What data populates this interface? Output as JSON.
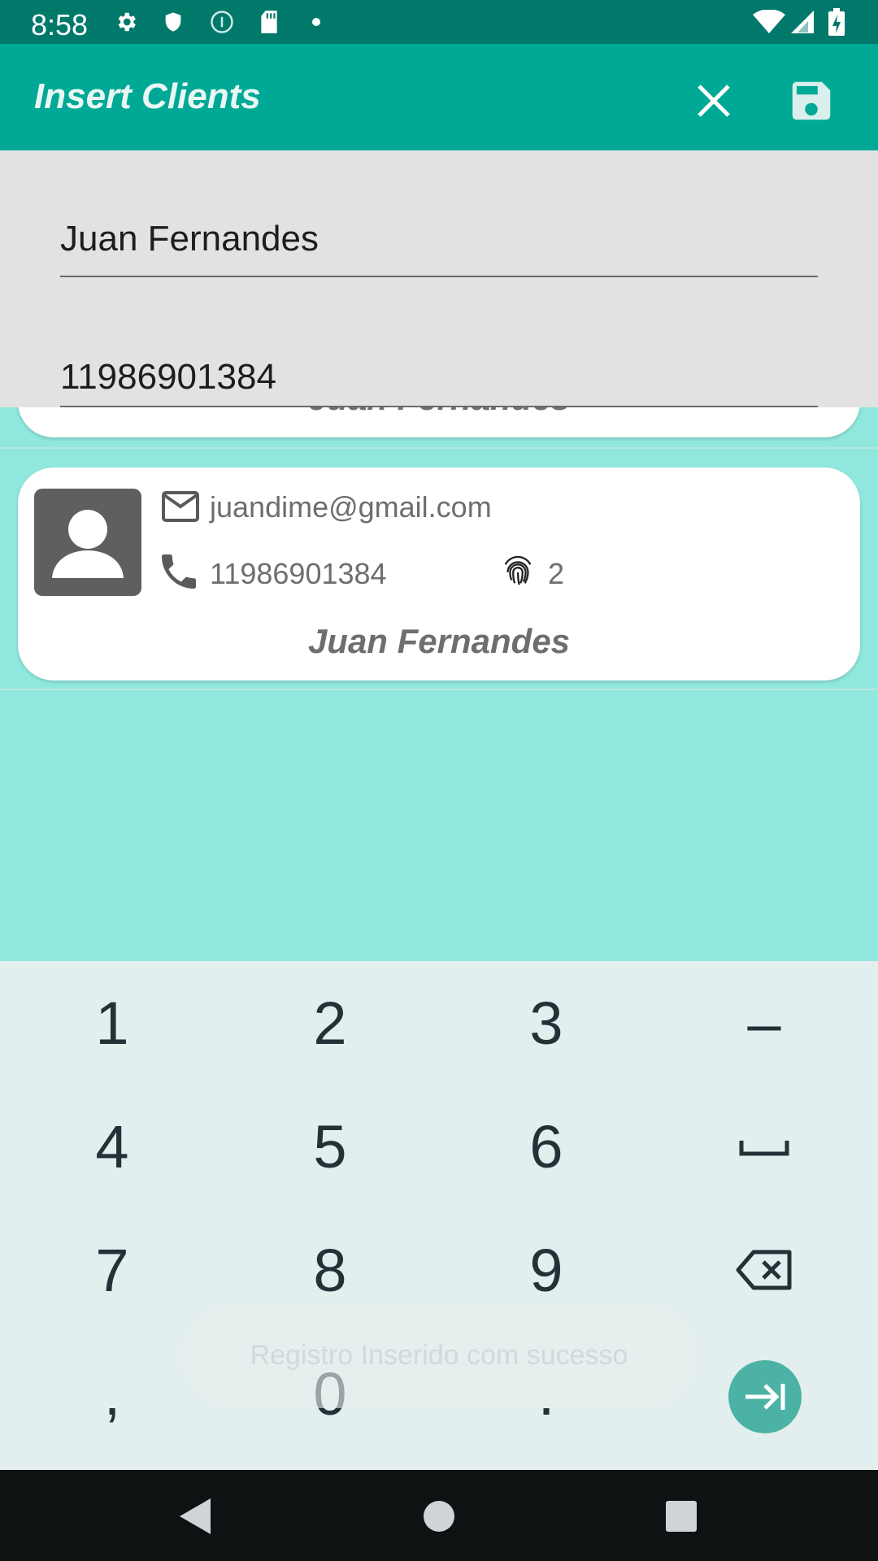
{
  "status_bar": {
    "time": "8:58",
    "icons": [
      "gear-icon",
      "shield-icon",
      "info-circle-icon",
      "sd-card-icon",
      "dot-icon",
      "wifi-icon",
      "signal-icon",
      "battery-icon"
    ]
  },
  "app_bar": {
    "title": "Insert Clients",
    "close_icon": "close-icon",
    "save_icon": "save-icon"
  },
  "form": {
    "name_value": "Juan Fernandes",
    "phone_value": "11986901384"
  },
  "list": {
    "partial_card_name": "Juan Fernandes",
    "card": {
      "email": "juandime@gmail.com",
      "phone": "11986901384",
      "id": "2",
      "name": "Juan Fernandes"
    }
  },
  "keyboard": {
    "row1": [
      "1",
      "2",
      "3",
      "–"
    ],
    "row2": [
      "4",
      "5",
      "6",
      "space"
    ],
    "row3": [
      "7",
      "8",
      "9",
      "backspace"
    ],
    "row4": [
      ",",
      "0",
      ".",
      "next"
    ]
  },
  "toast": {
    "message": "Registro Inserido com sucesso"
  },
  "colors": {
    "status_bar": "#00796b",
    "app_bar": "#00a995",
    "list_background": "#8fe7dd",
    "keyboard_background": "#e3eeee",
    "enter_key": "#4cb2a5"
  }
}
